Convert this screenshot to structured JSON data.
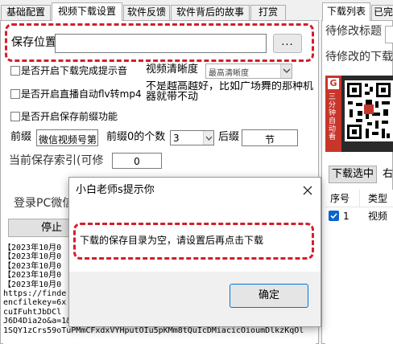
{
  "tabs": [
    "基础配置",
    "视频下载设置",
    "软件反馈",
    "软件背后的故事",
    "打赏"
  ],
  "right_tabs": [
    "下载列表",
    "已完"
  ],
  "save_location": {
    "label": "保存位置",
    "value": "",
    "browse_label": "..."
  },
  "options": {
    "download_done_prompt": "是否开启下载完成提示音",
    "live_flv_to_mp4": "是否开启直播自动flv转mp4",
    "prefix_enabled": "是否开启保存前缀功能"
  },
  "clarity": {
    "label": "视频清晰度",
    "value": "最高清晰度",
    "hint": "不是越高越好，比如广场舞的那种机器就带不动"
  },
  "prefix": {
    "label": "前缀",
    "value": "微信视频号第",
    "zero_count_label": "前缀0的个数",
    "zero_count_value": "3",
    "suffix_label": "后缀",
    "suffix_value": "节"
  },
  "save_index": {
    "label": "当前保存索引(可修",
    "value": "0"
  },
  "login_label": "登录PC微信",
  "stop_button": "停止软",
  "right": {
    "pending_title": "待修改标题",
    "pending_download": "待修改的下载",
    "qr_side_text": "三分钟自动看",
    "download_selected": "下载选中",
    "right_label": "右",
    "col_index": "序号",
    "col_type": "类型",
    "row_index": "1",
    "row_type": "视频"
  },
  "log_lines": [
    "【2023年10月0",
    "【2023年10月0",
    "【2023年10月0",
    "【2023年10月0",
    "【2023年10月0",
    "https://finde",
    "encfilekey=6x",
    "cuIFuhtJbDCl",
    "J6D4Dia2o&a=1&bizid=1023&dotrans=0&hy=SH&idx=1&m=6646249ec0eb4",
    "1SQY1zCrs59oTuPMmCFxdxVYHputOIu5pKMm8tQuIcDMiacicOioumDlkzKqOl"
  ],
  "dialog": {
    "title": "小白老师s提示你",
    "message": "下载的保存目录为空，请设置后再点击下载",
    "ok_label": "确定"
  }
}
